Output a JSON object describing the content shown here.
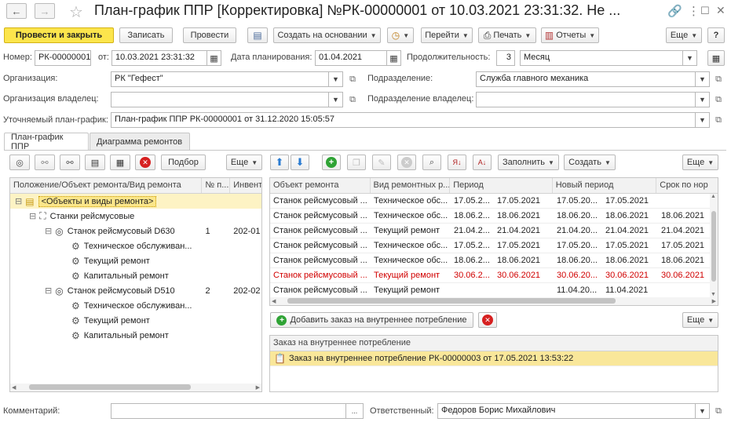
{
  "window": {
    "title": "План-график ППР [Корректировка] №РК-00000001 от 10.03.2021 23:31:32. Не ..."
  },
  "toolbar": {
    "post_close": "Провести и закрыть",
    "save": "Записать",
    "post": "Провести",
    "create_based": "Создать на основании",
    "go": "Перейти",
    "print": "Печать",
    "reports": "Отчеты",
    "more": "Еще",
    "help": "?"
  },
  "header": {
    "number_label": "Номер:",
    "number_value": "РК-00000001",
    "from_label": "от:",
    "date_value": "10.03.2021 23:31:32",
    "plan_date_label": "Дата планирования:",
    "plan_date_value": "01.04.2021",
    "duration_label": "Продолжительность:",
    "duration_value": "3",
    "duration_unit": "Месяц",
    "org_label": "Организация:",
    "org_value": "РК \"Гефест\"",
    "dept_label": "Подразделение:",
    "dept_value": "Служба главного механика",
    "org_owner_label": "Организация владелец:",
    "org_owner_value": "",
    "dept_owner_label": "Подразделение владелец:",
    "dept_owner_value": "",
    "refined_label": "Уточняемый план-график:",
    "refined_value": "План-график ППР РК-00000001 от 31.12.2020 15:05:57"
  },
  "tabs": [
    {
      "label": "План-график ППР"
    },
    {
      "label": "Диаграмма ремонтов"
    }
  ],
  "left_panel": {
    "select_btn": "Подбор",
    "more": "Еще",
    "columns": [
      "Положение/Объект ремонта/Вид ремонта",
      "№ п...",
      "Инвент"
    ],
    "tree": [
      {
        "label": "<Объекты и виды ремонта>",
        "num": "",
        "inv": ""
      },
      {
        "label": "Станки рейсмусовые",
        "num": "",
        "inv": ""
      },
      {
        "label": "Станок рейсмусовый D630",
        "num": "1",
        "inv": "202-01"
      },
      {
        "label": "Техническое обслуживан...",
        "num": "",
        "inv": ""
      },
      {
        "label": "Текущий ремонт",
        "num": "",
        "inv": ""
      },
      {
        "label": "Капитальный ремонт",
        "num": "",
        "inv": ""
      },
      {
        "label": "Станок рейсмусовый D510",
        "num": "2",
        "inv": "202-02"
      },
      {
        "label": "Техническое обслуживан...",
        "num": "",
        "inv": ""
      },
      {
        "label": "Текущий ремонт",
        "num": "",
        "inv": ""
      },
      {
        "label": "Капитальный ремонт",
        "num": "",
        "inv": ""
      }
    ]
  },
  "right_panel": {
    "fill_btn": "Заполнить",
    "create_btn": "Создать",
    "more": "Еще",
    "columns": [
      "Объект ремонта",
      "Вид ремонтных р...",
      "Период",
      "",
      "Новый период",
      "",
      "Срок по нор"
    ],
    "rows": [
      {
        "obj": "Станок рейсмусовый ...",
        "kind": "Техническое обс...",
        "p1": "17.05.2...",
        "p2": "17.05.2021",
        "n1": "17.05.20...",
        "n2": "17.05.2021",
        "term": "",
        "red": false
      },
      {
        "obj": "Станок рейсмусовый ...",
        "kind": "Техническое обс...",
        "p1": "18.06.2...",
        "p2": "18.06.2021",
        "n1": "18.06.20...",
        "n2": "18.06.2021",
        "term": "18.06.2021",
        "red": false
      },
      {
        "obj": "Станок рейсмусовый ...",
        "kind": "Текущий ремонт",
        "p1": "21.04.2...",
        "p2": "21.04.2021",
        "n1": "21.04.20...",
        "n2": "21.04.2021",
        "term": "21.04.2021",
        "red": false
      },
      {
        "obj": "Станок рейсмусовый ...",
        "kind": "Техническое обс...",
        "p1": "17.05.2...",
        "p2": "17.05.2021",
        "n1": "17.05.20...",
        "n2": "17.05.2021",
        "term": "17.05.2021",
        "red": false
      },
      {
        "obj": "Станок рейсмусовый ...",
        "kind": "Техническое обс...",
        "p1": "18.06.2...",
        "p2": "18.06.2021",
        "n1": "18.06.20...",
        "n2": "18.06.2021",
        "term": "18.06.2021",
        "red": false
      },
      {
        "obj": "Станок рейсмусовый ...",
        "kind": "Текущий ремонт",
        "p1": "30.06.2...",
        "p2": "30.06.2021",
        "n1": "30.06.20...",
        "n2": "30.06.2021",
        "term": "30.06.2021",
        "red": true
      },
      {
        "obj": "Станок рейсмусовый ...",
        "kind": "Текущий ремонт",
        "p1": "",
        "p2": "",
        "n1": "11.04.20...",
        "n2": "11.04.2021",
        "term": "",
        "red": false
      }
    ],
    "add_order_btn": "Добавить заказ на внутреннее потребление",
    "more2": "Еще",
    "orders_column": "Заказ на внутреннее потребление",
    "order_row": "Заказ на внутреннее потребление РК-00000003 от 17.05.2021 13:53:22"
  },
  "footer": {
    "comment_label": "Комментарий:",
    "comment_value": "",
    "comment_more": "...",
    "responsible_label": "Ответственный:",
    "responsible_value": "Федоров Борис Михайлович"
  }
}
